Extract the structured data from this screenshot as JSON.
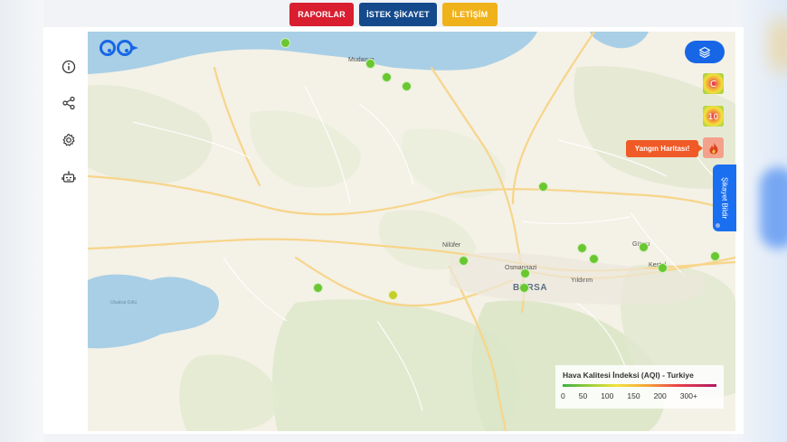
{
  "nav": {
    "raporlar": "RAPORLAR",
    "istek": "İSTEK ŞİKAYET",
    "iletisim": "İLETİŞİM"
  },
  "sidebar": {
    "icons": [
      "info-icon",
      "share-icon",
      "settings-icon",
      "robot-icon"
    ]
  },
  "map": {
    "labels": {
      "mudanya": "Mudanya",
      "nilufer": "Nilüfer",
      "osmangazi": "Osmangazi",
      "bursa": "BURSA",
      "yildirim": "Yıldırım",
      "gursu": "Gürsu",
      "kestel": "Kestel",
      "uluabat": "Uluabat Gölü"
    },
    "station_colors": {
      "good": "#69c72f",
      "moderate": "#c5cf2c"
    }
  },
  "controls": {
    "fire_map_label": "Yangın Haritası!",
    "complaint_tab": "Şikayet Bildir"
  },
  "legend": {
    "title": "Hava Kalitesi İndeksi (AQI) - Turkiye",
    "ticks": [
      "0",
      "50",
      "100",
      "150",
      "200",
      "300+"
    ]
  }
}
